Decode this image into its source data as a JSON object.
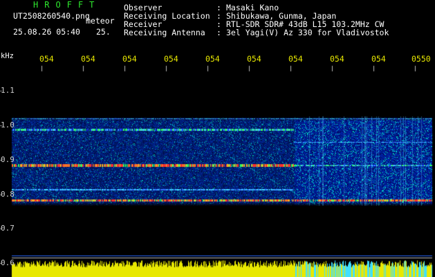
{
  "header": {
    "app_title": "HROFFT",
    "filename": "UT2508260540.png",
    "meteor_label": "meteor",
    "datetime": "25.08.26 05:40",
    "count": "25."
  },
  "metadata": [
    {
      "label": "Observer",
      "sep": ":",
      "value": "Masaki Kano"
    },
    {
      "label": "Receiving Location",
      "sep": ":",
      "value": "Shibukawa, Gunma, Japan"
    },
    {
      "label": "Receiver",
      "sep": ":",
      "value": "RTL-SDR SDR# 43dB L15 103.2MHz CW"
    },
    {
      "label": "Receiving Antenna",
      "sep": ":",
      "value": "3el Yagi(V) Az 330 for Vladivostok"
    }
  ],
  "axis": {
    "unit": "kHz",
    "y_labels": [
      "1.1",
      "1.0",
      "0.9",
      "0.8",
      "0.7",
      "0.6"
    ],
    "time_labels": [
      "054",
      "054",
      "054",
      "054",
      "054",
      "054",
      "054",
      "054",
      "054",
      "0550"
    ]
  },
  "colors": {
    "title": "#2ee82e",
    "meta_text": "#ffffff",
    "time_ticks": "#e8e800",
    "band_bg": "#0a1a8a",
    "signal_strong": "#ff3030",
    "signal_mid": "#30ff60",
    "amplitude": "#e8e800"
  }
}
